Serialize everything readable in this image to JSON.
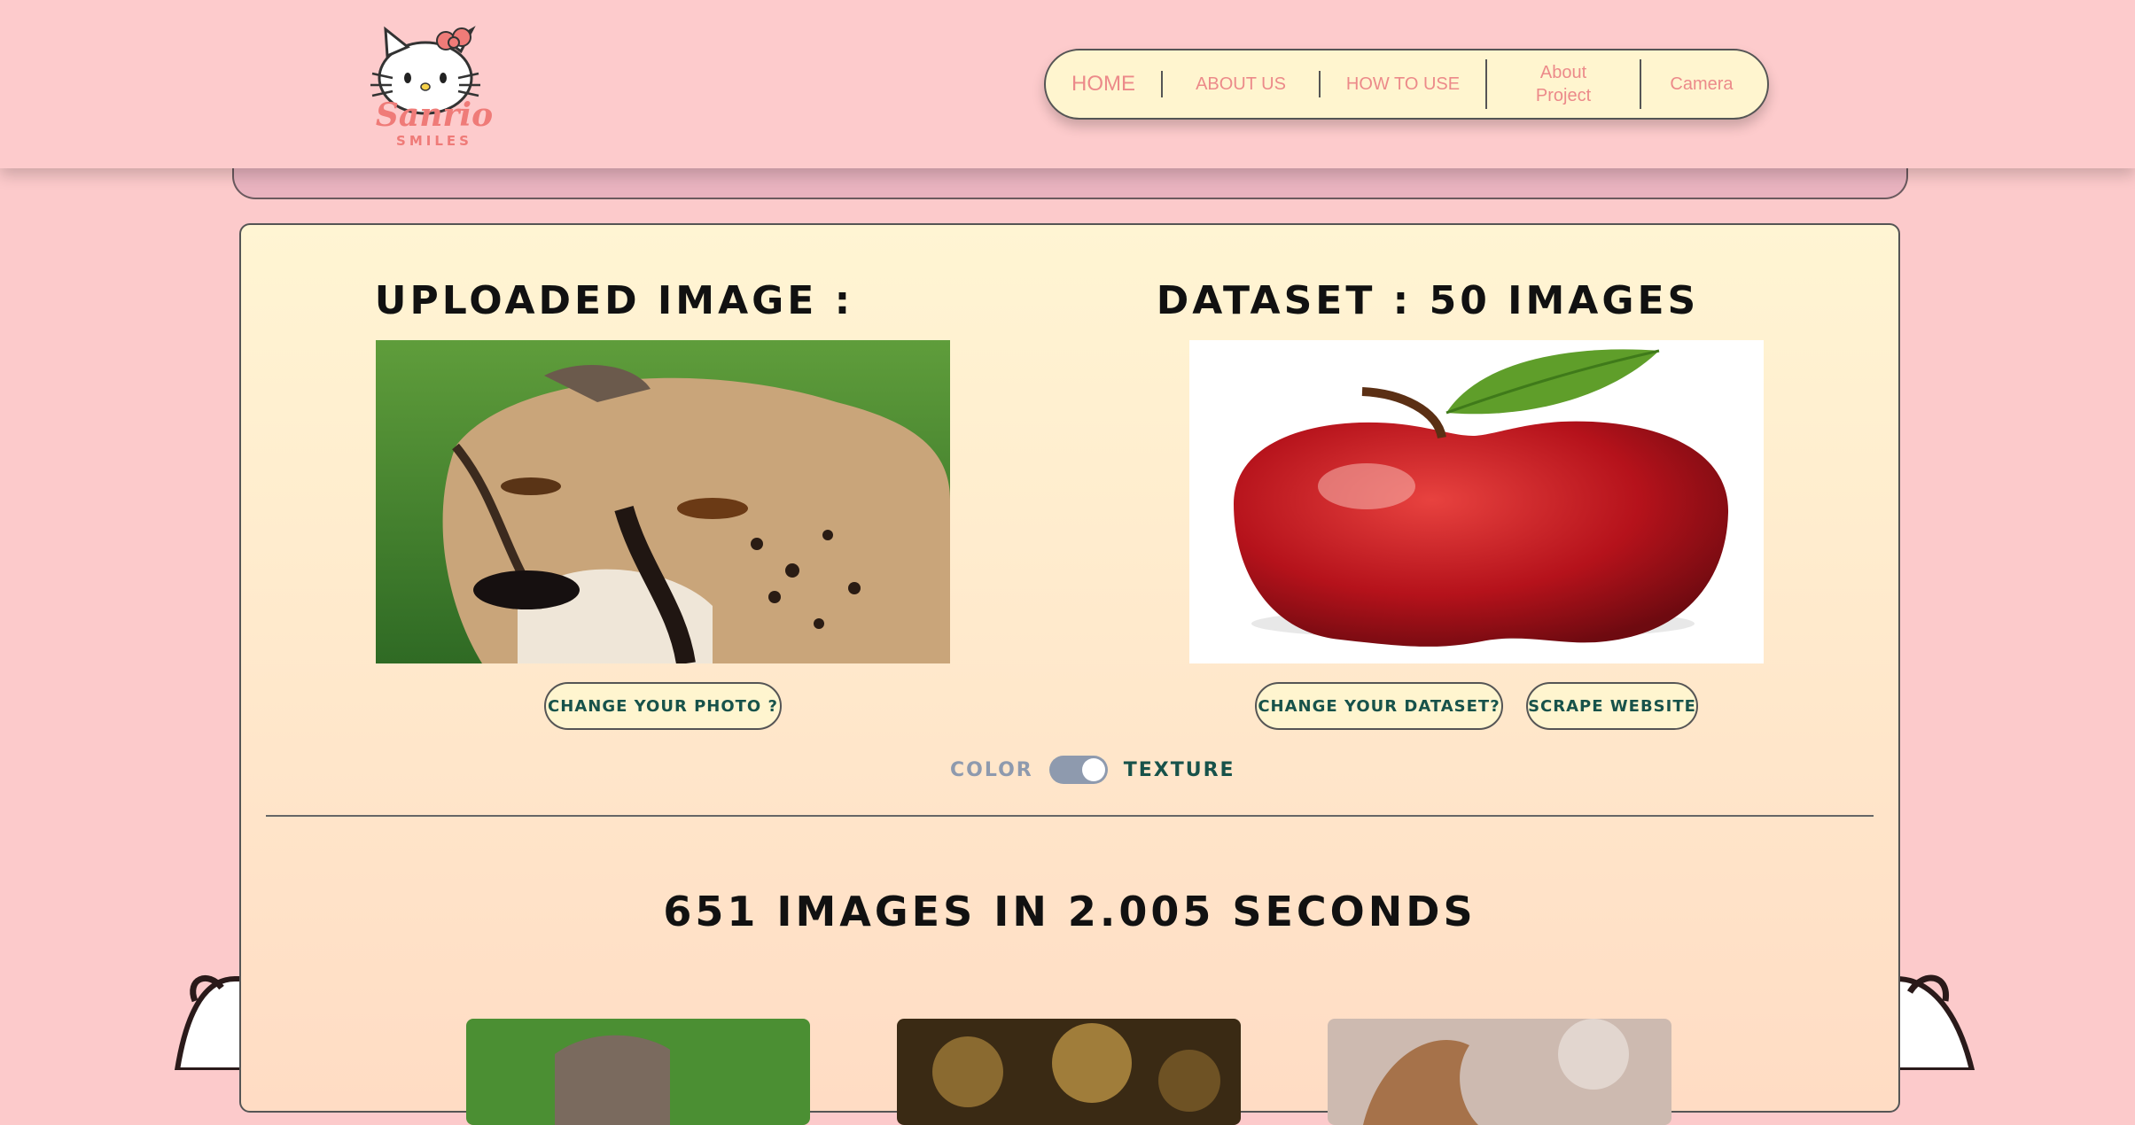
{
  "brand": {
    "logo_word": "Sanrio",
    "logo_sub": "SMILES"
  },
  "nav": {
    "items": [
      {
        "id": "home",
        "label": "HOME"
      },
      {
        "id": "about-us",
        "label": "ABOUT US"
      },
      {
        "id": "how-to-use",
        "label": "HOW TO USE"
      },
      {
        "id": "about-project",
        "label": "About Project"
      },
      {
        "id": "camera",
        "label": "Camera"
      }
    ]
  },
  "main": {
    "uploaded_title": "UPLOADED IMAGE :",
    "dataset_title": "DATASET : 50 IMAGES",
    "change_photo": "CHANGE YOUR PHOTO ?",
    "change_dataset": "CHANGE YOUR DATASET?",
    "scrape_website": "SCRAPE WEBSITE",
    "toggle": {
      "left_label": "COLOR",
      "right_label": "TEXTURE",
      "state": "TEXTURE"
    },
    "result_text": "651 IMAGES IN 2.005 SECONDS"
  },
  "colors": {
    "page_bg": "#fccacb",
    "nav_text": "#ec8a8a",
    "button_text": "#17524a",
    "toggle_inactive": "#8e9aae"
  }
}
